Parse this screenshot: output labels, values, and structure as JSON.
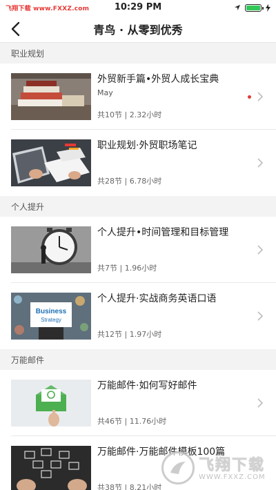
{
  "status_bar": {
    "watermark_text": "飞翔下载 www.FXXZ.com",
    "time": "10:29 PM",
    "battery_level_percent": 100,
    "battery_color": "#34c759"
  },
  "nav": {
    "back_icon": "chevron-left-icon",
    "title": "青鸟 · 从零到优秀"
  },
  "sections": [
    {
      "header": "职业规划",
      "courses": [
        {
          "title": "外贸新手篇•外贸人成长宝典",
          "subtitle": "May",
          "meta": "共10节 | 2.32小时",
          "has_new_dot": true
        },
        {
          "title": "职业规划·外贸职场笔记",
          "subtitle": "",
          "meta": "共28节 | 6.78小时",
          "has_new_dot": false
        }
      ]
    },
    {
      "header": "个人提升",
      "courses": [
        {
          "title": "个人提升•时间管理和目标管理",
          "subtitle": "",
          "meta": "共7节 | 1.96小时",
          "has_new_dot": false
        },
        {
          "title": "个人提升·实战商务英语口语",
          "subtitle": "",
          "meta": "共12节 | 1.97小时",
          "has_new_dot": false
        }
      ]
    },
    {
      "header": "万能邮件",
      "courses": [
        {
          "title": "万能邮件·如何写好邮件",
          "subtitle": "",
          "meta": "共46节 | 11.76小时",
          "has_new_dot": false
        },
        {
          "title": "万能邮件·万能邮件模板100篇",
          "subtitle": "",
          "meta": "共38节 | 8.21小时",
          "has_new_dot": false
        }
      ]
    }
  ],
  "thumbnail_texts": {
    "business_strategy_line1": "Business",
    "business_strategy_line2": "Strategy"
  },
  "watermark_logo": {
    "name": "飞翔下载",
    "url": "WWW.FXXZ.COM"
  },
  "colors": {
    "accent_red": "#e53935",
    "section_bg": "#f3f3f3",
    "divider": "#e8e8e8"
  }
}
